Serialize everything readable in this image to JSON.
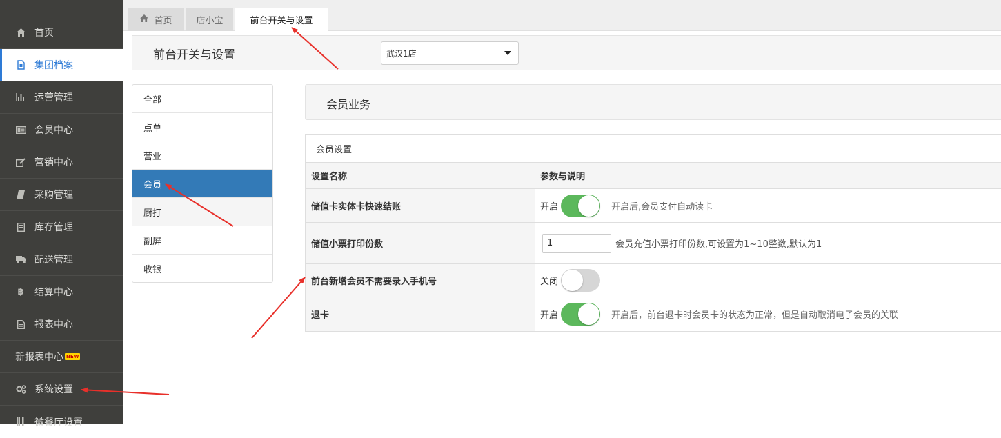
{
  "sidebar": {
    "items": [
      {
        "label": "首页",
        "icon": "home-icon"
      },
      {
        "label": "集团档案",
        "icon": "file-icon"
      },
      {
        "label": "运营管理",
        "icon": "bar-chart-icon"
      },
      {
        "label": "会员中心",
        "icon": "id-card-icon"
      },
      {
        "label": "营销中心",
        "icon": "edit-icon"
      },
      {
        "label": "采购管理",
        "icon": "book-icon"
      },
      {
        "label": "库存管理",
        "icon": "box-icon"
      },
      {
        "label": "配送管理",
        "icon": "truck-icon"
      },
      {
        "label": "结算中心",
        "icon": "bitcoin-icon"
      },
      {
        "label": "报表中心",
        "icon": "report-icon"
      },
      {
        "label": "新报表中心",
        "badge": "NEW"
      },
      {
        "label": "系统设置",
        "icon": "gears-icon"
      },
      {
        "label": "微餐厅设置",
        "icon": "cutlery-icon"
      }
    ]
  },
  "tabs": [
    {
      "label": "首页",
      "icon": "home-icon"
    },
    {
      "label": "店小宝"
    },
    {
      "label": "前台开关与设置"
    }
  ],
  "header": {
    "title": "前台开关与设置",
    "store_select": "武汉1店"
  },
  "categories": [
    "全部",
    "点单",
    "营业",
    "会员",
    "厨打",
    "副屏",
    "收银"
  ],
  "section": {
    "title": "会员业务"
  },
  "panel": {
    "title": "会员设置",
    "col_name": "设置名称",
    "col_param": "参数与说明",
    "rows": [
      {
        "name": "储值卡实体卡快速结账",
        "toggle_label": "开启",
        "toggle_on": true,
        "desc": "开启后,会员支付自动读卡"
      },
      {
        "name": "储值小票打印份数",
        "input_value": "1",
        "desc": "会员充值小票打印份数,可设置为1~10整数,默认为1"
      },
      {
        "name": "前台新增会员不需要录入手机号",
        "toggle_label": "关闭",
        "toggle_on": false
      },
      {
        "name": "退卡",
        "toggle_label": "开启",
        "toggle_on": true,
        "desc": "开启后，前台退卡时会员卡的状态为正常，但是自动取消电子会员的关联"
      }
    ]
  },
  "colors": {
    "sidebar_bg": "#3f3f3c",
    "accent_blue": "#337ab7",
    "toggle_on": "#5cb85c",
    "annotation_arrow": "#e8302a"
  }
}
